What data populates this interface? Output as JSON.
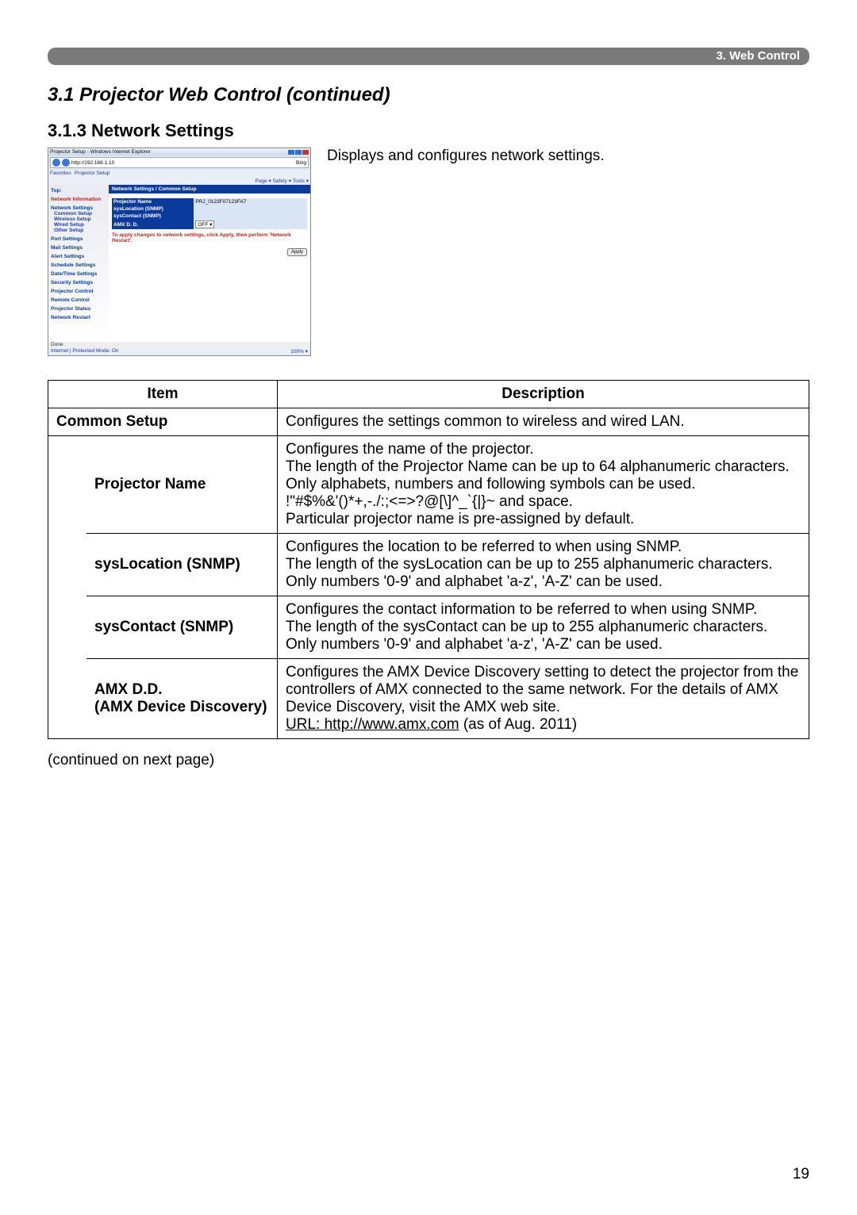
{
  "chapter": "3. Web Control",
  "section_title": "3.1 Projector Web Control (continued)",
  "subsection_title": "3.1.3 Network Settings",
  "intro_text": "Displays and configures network settings.",
  "continued_text": "(continued on next page)",
  "page_number": "19",
  "screenshot": {
    "window_title": "Projector Setup - Windows Internet Explorer",
    "url": "http://192.168.1.10",
    "search_hint": "Bing",
    "favorites_label": "Favorites",
    "tab_label": "Projector Setup",
    "toolbar_links": "Page ▾  Safety ▾  Tools ▾",
    "panel_title": "Network Settings / Common Setup",
    "sidebar": {
      "top": "Top:",
      "net_info": "Network Information",
      "net_settings": "Network Settings",
      "common": "Common Setup",
      "wireless": "Wireless Setup",
      "wired": "Wired Setup",
      "other": "Other Setup",
      "port": "Port Settings",
      "mail": "Mail Settings",
      "alert": "Alert Settings",
      "schedule": "Schedule Settings",
      "datetime": "Date/Time Settings",
      "security": "Security Settings",
      "projctrl": "Projector Control",
      "remote": "Remote Control",
      "status": "Projector Status",
      "restart": "Network Restart"
    },
    "form": {
      "projector_name_label": "Projector Name",
      "projector_name_value": "PRJ_0123F07123FA7",
      "syslocation_label": "sysLocation (SNMP)",
      "syslocation_value": "",
      "syscontact_label": "sysContact (SNMP)",
      "syscontact_value": "",
      "amx_label": "AMX D. D.",
      "amx_value": "OFF ▾",
      "warn": "To apply changes to network settings, click Apply, then perform 'Network Restart'.",
      "apply_label": "Apply"
    },
    "status_left": "Done",
    "status_mid": "Internet | Protected Mode: On",
    "status_right": "100%  ▾"
  },
  "table": {
    "header_item": "Item",
    "header_desc": "Description",
    "rows": [
      {
        "item": "Common Setup",
        "is_group": true,
        "desc": "Configures the settings common to wireless and wired LAN."
      },
      {
        "item": "Projector Name",
        "desc": "Configures the name of the projector.\nThe length of the Projector Name can be up to 64 alphanumeric characters. Only alphabets, numbers and following symbols can be used.\n !\"#$%&'()*+,-./:;<=>?@[\\]^_`{|}~ and space.\nParticular projector name is pre-assigned by default."
      },
      {
        "item": "sysLocation (SNMP)",
        "desc": "Configures the location to be referred to when using SNMP.\nThe length of the sysLocation can be up to 255 alphanumeric characters. Only numbers '0-9' and alphabet 'a-z', 'A-Z' can be used."
      },
      {
        "item": "sysContact (SNMP)",
        "desc": "Configures the contact information to be referred to when using SNMP.\nThe length of the sysContact can be up to 255 alphanumeric characters. Only numbers '0-9' and alphabet 'a-z', 'A-Z' can be used."
      }
    ],
    "amx": {
      "item": "AMX D.D.\n(AMX Device Discovery)",
      "desc_pre": "Configures the AMX Device Discovery setting to detect the projector from the controllers of AMX connected to the same network. For the details of AMX Device Discovery, visit the AMX web site.",
      "url_label": "URL: http://www.amx.com",
      "desc_post": " (as of Aug. 2011)"
    }
  }
}
